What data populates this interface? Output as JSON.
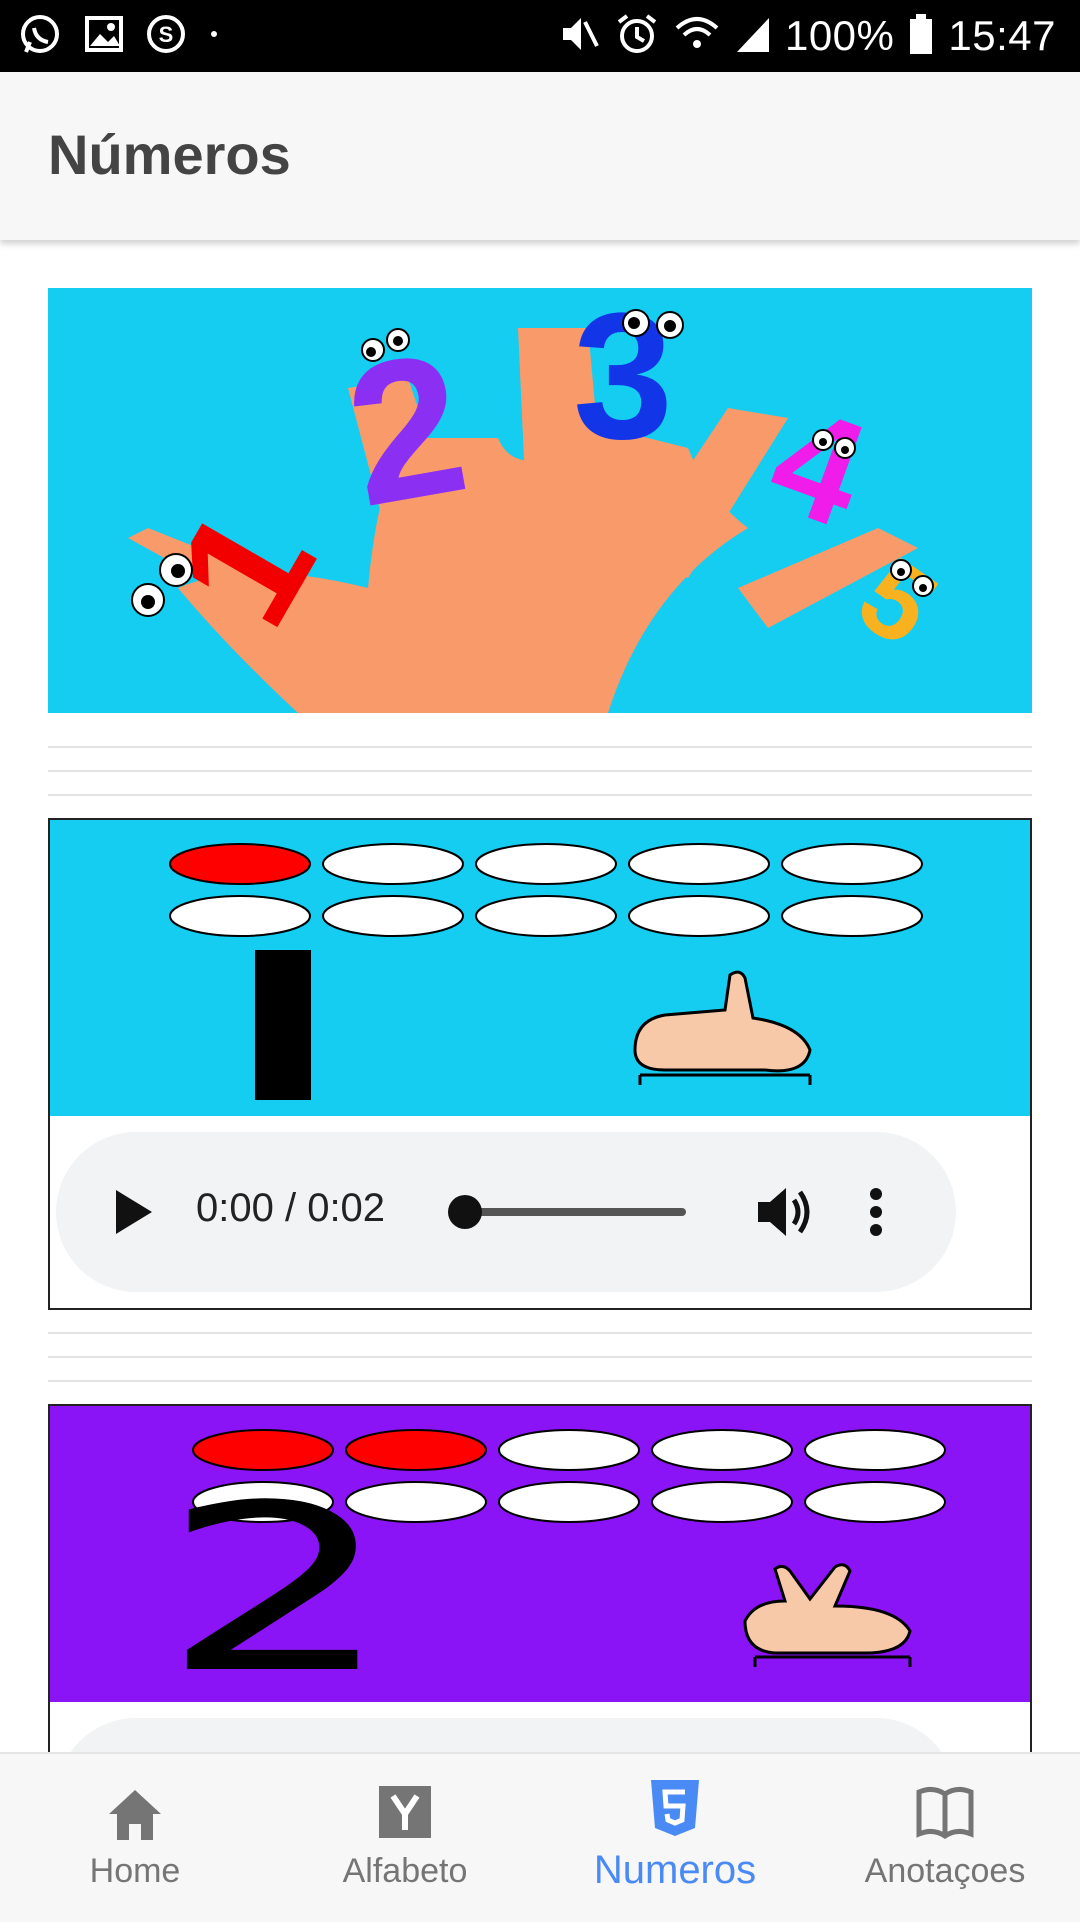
{
  "status_bar": {
    "battery": "100%",
    "time": "15:47",
    "left_icons": [
      "whatsapp-icon",
      "gallery-icon",
      "skype-icon",
      "dot-icon"
    ],
    "right_icons": [
      "mute-icon",
      "alarm-icon",
      "wifi-icon",
      "signal-icon",
      "battery-icon"
    ]
  },
  "app_bar": {
    "title": "Números"
  },
  "hero": {
    "image": "five-numbered-fingers-illustration",
    "numbers": [
      "1",
      "2",
      "3",
      "4",
      "5"
    ]
  },
  "cards": [
    {
      "number": "1",
      "background_color": "#14cdf1",
      "filled_count": 1,
      "total_count": 10,
      "hand_icon": "one-finger-hand-icon",
      "audio": {
        "time": "0:00 / 0:02",
        "progress": 0
      }
    },
    {
      "number": "2",
      "background_color": "#8a14f6",
      "filled_count": 2,
      "total_count": 10,
      "hand_icon": "two-finger-hand-icon"
    }
  ],
  "bottom_nav": {
    "items": [
      {
        "label": "Home",
        "icon": "home-icon",
        "active": false
      },
      {
        "label": "Alfabeto",
        "icon": "alphabet-icon",
        "active": false
      },
      {
        "label": "Numeros",
        "icon": "html5-icon",
        "active": true
      },
      {
        "label": "Anotaçoes",
        "icon": "book-icon",
        "active": false
      }
    ]
  },
  "colors": {
    "accent": "#4a8af4",
    "filled_oval": "#ff0000"
  }
}
